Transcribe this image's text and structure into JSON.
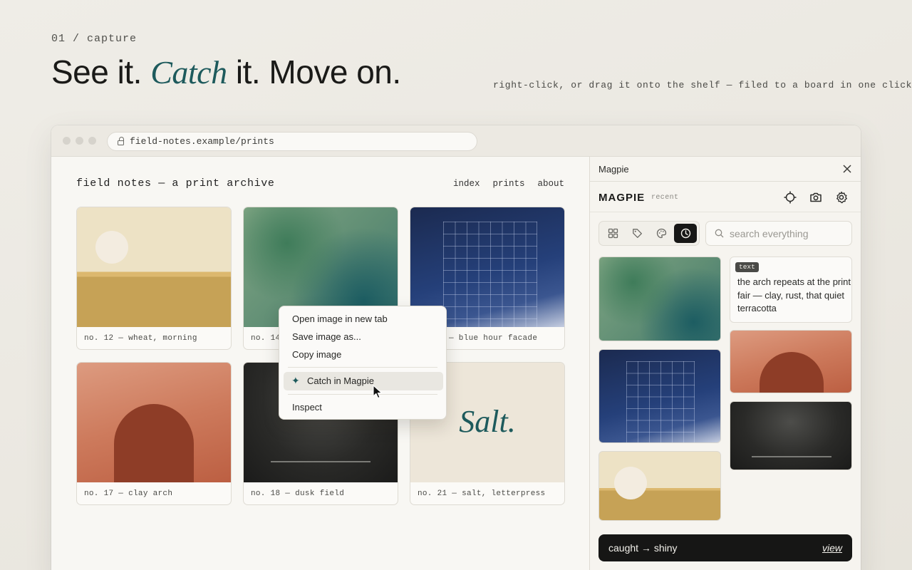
{
  "hero": {
    "eyebrow": "01 / capture",
    "headline_part1": "See it. ",
    "headline_accent": "Catch",
    "headline_part2": " it. Move on.",
    "tagline": "right-click, or drag it onto the shelf — filed to a board in one click"
  },
  "browser": {
    "url": "field-notes.example/prints"
  },
  "site": {
    "title": "field notes — a print archive",
    "nav": [
      "index",
      "prints",
      "about"
    ],
    "cards": [
      {
        "caption": "no. 12 — wheat, morning"
      },
      {
        "caption": "no. 14"
      },
      {
        "caption": "— blue hour facade"
      },
      {
        "caption": "no. 17 — clay arch"
      },
      {
        "caption": "no. 18 — dusk field"
      },
      {
        "caption": "no. 21 — salt, letterpress",
        "art_text": "Salt."
      }
    ]
  },
  "context_menu": {
    "items": [
      "Open image in new tab",
      "Save image as...",
      "Copy image"
    ],
    "highlight": "Catch in Magpie",
    "inspect": "Inspect"
  },
  "panel": {
    "header": "Magpie",
    "logo": "MAGPIE",
    "logo_sub": "recent",
    "tools": [
      "crosshair-icon",
      "camera-icon",
      "gear-icon"
    ],
    "filters": [
      "grid-icon",
      "tag-icon",
      "palette-icon",
      "clock-icon"
    ],
    "active_filter": "clock-icon",
    "search_placeholder": "search everything",
    "note": {
      "tag": "text",
      "text": "the arch repeats at the print fair — clay, rust, that quiet terracotta"
    },
    "toast": {
      "message": "caught → shiny",
      "action": "view"
    }
  },
  "colors": {
    "accent": "#1d5a5c",
    "toast_bg": "#161615"
  }
}
